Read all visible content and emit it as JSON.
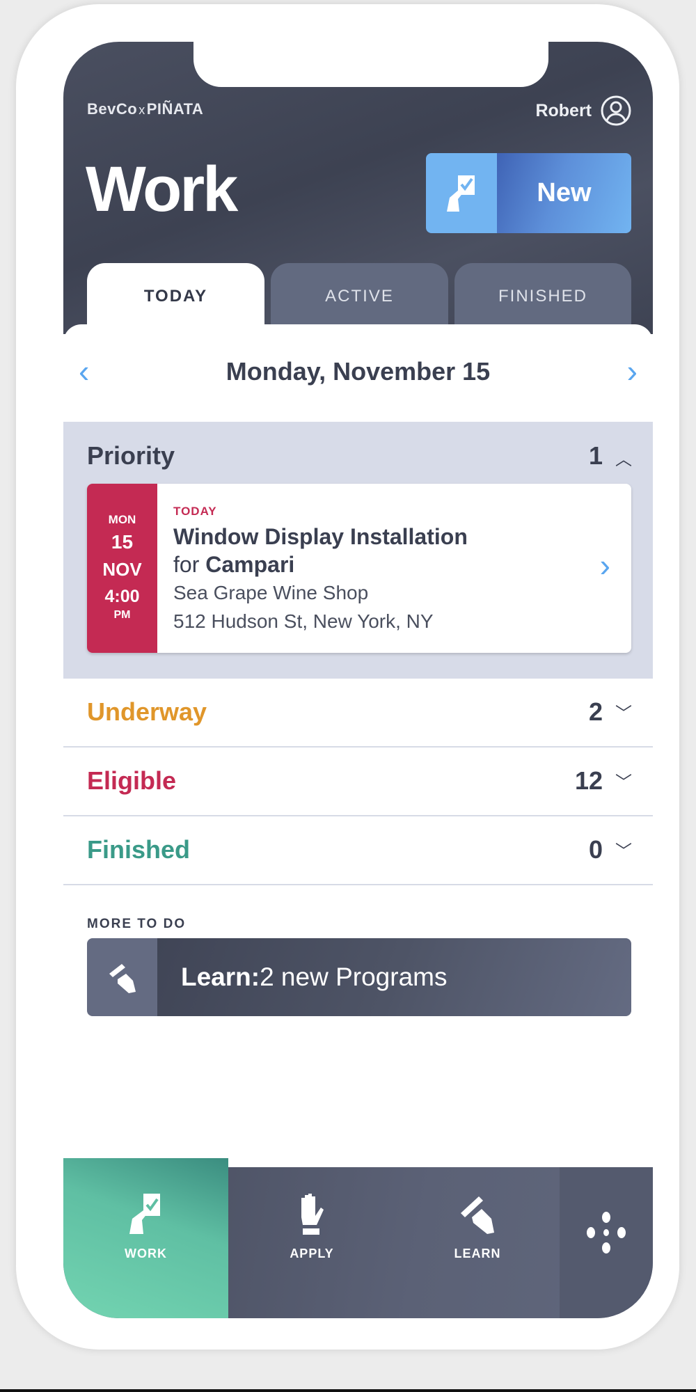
{
  "header": {
    "brand_left": "BevCo",
    "brand_x": "x",
    "brand_right": "PIÑATA",
    "user_name": "Robert",
    "title": "Work",
    "new_button": "New"
  },
  "tabs": [
    {
      "label": "TODAY",
      "active": true
    },
    {
      "label": "ACTIVE",
      "active": false
    },
    {
      "label": "FINISHED",
      "active": false
    }
  ],
  "date": {
    "label": "Monday, November 15",
    "prev_icon": "chevron-left",
    "next_icon": "chevron-right"
  },
  "priority": {
    "label": "Priority",
    "count": "1",
    "expanded": true,
    "card": {
      "day": "MON",
      "date": "15",
      "month": "NOV",
      "time": "4:00",
      "ampm": "PM",
      "tag": "TODAY",
      "title": "Window Display Installation",
      "for_label": "for",
      "brand": "Campari",
      "store": "Sea Grape Wine Shop",
      "address": "512 Hudson St, New York, NY"
    }
  },
  "sections": [
    {
      "label": "Underway",
      "count": "2",
      "color": "#e0962a"
    },
    {
      "label": "Eligible",
      "count": "12",
      "color": "#c42a53"
    },
    {
      "label": "Finished",
      "count": "0",
      "color": "#3a9a88"
    }
  ],
  "more": {
    "heading": "MORE TO DO",
    "learn_bold": "Learn:",
    "learn_text": " 2 new Programs"
  },
  "nav": [
    {
      "label": "WORK",
      "icon": "hand-ballot-icon",
      "active": true
    },
    {
      "label": "APPLY",
      "icon": "raised-hand-icon"
    },
    {
      "label": "LEARN",
      "icon": "hand-pencil-icon"
    }
  ],
  "colors": {
    "accent_blue": "#5aa6ef",
    "priority_red": "#c42a53",
    "work_green": "#5fbfa3",
    "header_dark": "#434859"
  }
}
